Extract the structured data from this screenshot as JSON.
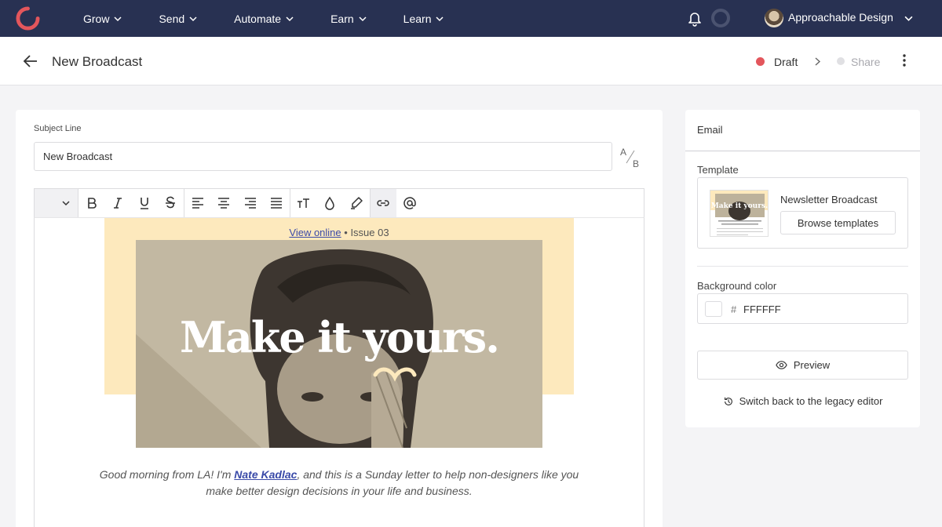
{
  "nav": {
    "items": [
      {
        "label": "Grow"
      },
      {
        "label": "Send"
      },
      {
        "label": "Automate"
      },
      {
        "label": "Earn"
      },
      {
        "label": "Learn"
      }
    ],
    "account_name": "Approachable Design",
    "brand_color": "#e3565c",
    "bg_color": "#283152"
  },
  "header": {
    "title": "New Broadcast",
    "status": "Draft",
    "next_step": "Share"
  },
  "editor": {
    "subject_label": "Subject Line",
    "subject_value": "New Broadcast",
    "ab_top": "A",
    "ab_bottom": "B",
    "toolbar_icons": [
      "bold-icon",
      "italic-icon",
      "underline-icon",
      "strikethrough-icon",
      "align-left-icon",
      "align-center-icon",
      "align-right-icon",
      "align-justify-icon",
      "text-size-icon",
      "color-drop-icon",
      "highlighter-icon",
      "link-icon",
      "mention-icon"
    ],
    "view_online": "View online",
    "issue": "• Issue 03",
    "hero_title": "Make it yours.",
    "body_prefix": "Good morning from LA! I'm ",
    "body_link": "Nate Kadlac",
    "body_suffix": ", and this is a Sunday letter to help non-designers like you make better design decisions in your life and business."
  },
  "sidebar": {
    "tab": "Email",
    "template_label": "Template",
    "template_name": "Newsletter Broadcast",
    "browse_button": "Browse templates",
    "thumb_title": "Make it yours.",
    "background_label": "Background color",
    "hash": "#",
    "background_value": "FFFFFF",
    "preview_button": "Preview",
    "legacy_link": "Switch back to the legacy editor"
  }
}
